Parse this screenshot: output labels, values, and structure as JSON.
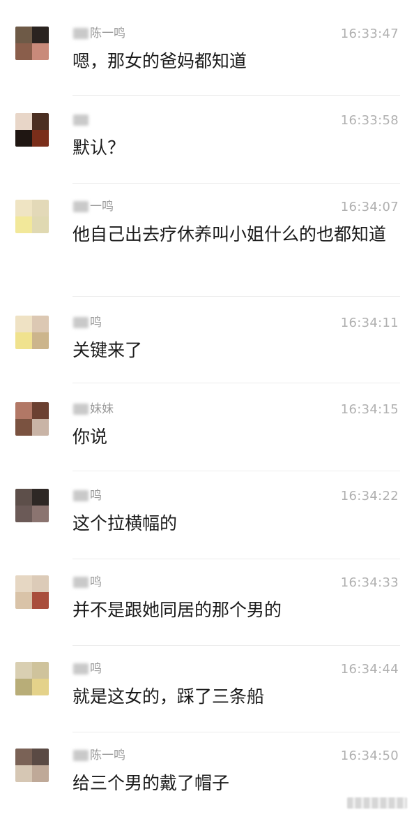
{
  "messages": [
    {
      "sender": "陈一鸣",
      "time": "16:33:47",
      "text": "嗯，那女的爸妈都知道",
      "avatar": [
        "#6e5a47",
        "#2a2320",
        "#8a5e4b",
        "#c98a7a"
      ]
    },
    {
      "sender": "",
      "time": "16:33:58",
      "text": "默认？",
      "avatar": [
        "#e8d6c8",
        "#4b2f22",
        "#1f1612",
        "#7a2e1a"
      ]
    },
    {
      "sender": "一鸣",
      "time": "16:34:07",
      "text": "他自己出去疗休养叫小姐什么的也都知道",
      "avatar": [
        "#efe4c3",
        "#e3d9b8",
        "#f2e89a",
        "#e0d9b2"
      ]
    },
    {
      "sender": "鸣",
      "time": "16:34:11",
      "text": "关键来了",
      "avatar": [
        "#efe2c4",
        "#dcc8b3",
        "#f0e28e",
        "#ccb58c"
      ]
    },
    {
      "sender": "妹妹",
      "time": "16:34:15",
      "text": "你说",
      "avatar": [
        "#b27866",
        "#6b4031",
        "#7a5240",
        "#c9b4a6"
      ]
    },
    {
      "sender": "鸣",
      "time": "16:34:22",
      "text": "这个拉横幅的",
      "avatar": [
        "#5d4f4a",
        "#2e2825",
        "#6b5a57",
        "#8b7470"
      ]
    },
    {
      "sender": "鸣",
      "time": "16:34:33",
      "text": "并不是跟她同居的那个男的",
      "avatar": [
        "#e6d7c3",
        "#dccbb8",
        "#d9c3a8",
        "#a94e3c"
      ]
    },
    {
      "sender": "鸣",
      "time": "16:34:44",
      "text": "就是这女的，踩了三条船",
      "avatar": [
        "#d9cfb2",
        "#cfc39c",
        "#b8ad78",
        "#e4d28a"
      ]
    },
    {
      "sender": "陈一鸣",
      "time": "16:34:50",
      "text": "给三个男的戴了帽子",
      "avatar": [
        "#7a6256",
        "#5a4a44",
        "#d6c7b4",
        "#bfa998"
      ]
    }
  ]
}
